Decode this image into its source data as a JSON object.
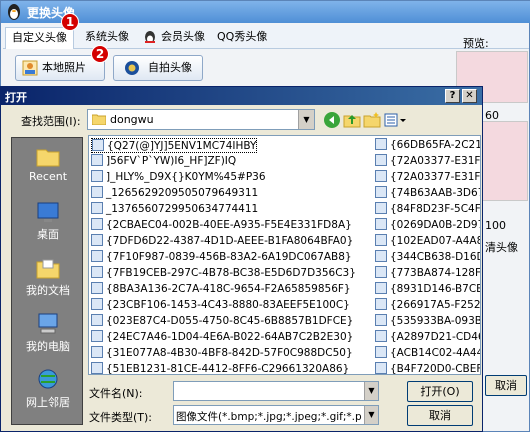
{
  "window": {
    "title": "更换头像"
  },
  "tabs": [
    "自定义头像",
    "系统头像",
    "会员头像",
    "QQ秀头像"
  ],
  "badges": [
    "1",
    "2"
  ],
  "buttons": {
    "local_photo": "本地照片",
    "selfie": "自拍头像"
  },
  "preview": {
    "label": "预览:",
    "side_text_1": "60",
    "side_text_2": "100",
    "side_text_3": "清头像"
  },
  "outer_cancel": "取消",
  "dialog": {
    "title": "打开",
    "look_in_label": "查找范围(I):",
    "look_in_value": "dongwu",
    "places": [
      "Recent",
      "桌面",
      "我的文档",
      "我的电脑",
      "网上邻居"
    ],
    "files_left": [
      "{Q27(@]YJ]5ENV1MC74IHBY",
      "]56FV`P`YW)I6_HF]ZF)IQ",
      "]_HLY%_D9X{}K0YM%45#P36",
      "_1265629209505079649311",
      "_1376560729950634774411",
      "{2CBAEC04-002B-40EE-A935-F5E4E331FD8A}",
      "{7DFD6D22-4387-4D1D-AEEE-B1FA8064BFA0}",
      "{7F10F987-0839-456B-83A2-6A19DC067AB8}",
      "{7FB19CEB-297C-4B78-BC38-E5D6D7D356C3}",
      "{8BA3A136-2C7A-418C-9654-F2A65859856F}",
      "{23CBF106-1453-4C43-8880-83AEEF5E100C}",
      "{023E87C4-D055-4750-8C45-6B8857B1DFCE}",
      "{24EC7A46-1D04-4E6A-B022-64AB7C2B2E30}",
      "{31E077A8-4B30-4BF8-842D-57F0C988DC50}",
      "{51EB1231-81CE-4412-8FF6-C29661320A86}"
    ],
    "files_right": [
      "{66DB65FA-2C21-4",
      "{72A03377-E31F-4E",
      "{72A03377-E31F-4E",
      "{74B63AAB-3D67-43",
      "{84F8D23F-5C4F-4E",
      "{0269DA0B-2D97-4D",
      "{102EAD07-A4A8-46",
      "{344CB638-D16D-45",
      "{773BA874-128F-46",
      "{8931D146-B7CE-43",
      "{266917A5-F252-4C",
      "{535933BA-093B-45",
      "{A2897D21-CD46-4",
      "{ACB14C02-4A44-4F",
      "{B4F720D0-CBEF-4D"
    ],
    "file_name_label": "文件名(N):",
    "file_name_value": "",
    "file_type_label": "文件类型(T):",
    "file_type_value": "图像文件(*.bmp;*.jpg;*.jpeg;*.gif;*.p",
    "open_button": "打开(O)",
    "cancel_button": "取消"
  }
}
